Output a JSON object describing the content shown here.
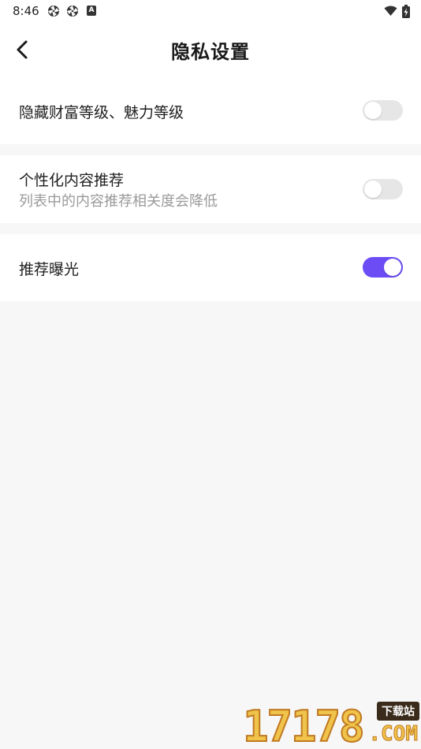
{
  "status_bar": {
    "time": "8:46",
    "left_icons": [
      "aperture-icon",
      "aperture-icon",
      "a-badge-icon"
    ],
    "a_badge": "A",
    "right_icons": [
      "wifi-icon",
      "battery-charging-icon"
    ]
  },
  "header": {
    "title": "隐私设置",
    "back_icon": "chevron-left-icon"
  },
  "settings": [
    {
      "title": "隐藏财富等级、魅力等级",
      "subtitle": "",
      "enabled": false
    },
    {
      "title": "个性化内容推荐",
      "subtitle": "列表中的内容推荐相关度会降低",
      "enabled": false
    },
    {
      "title": "推荐曝光",
      "subtitle": "",
      "enabled": true
    }
  ],
  "colors": {
    "accent": "#6b4cf5",
    "switch_off": "#e6e6e6",
    "background": "#f7f7f7",
    "subtitle": "#9a9a9a"
  },
  "watermark": {
    "digits": "17178",
    "tag": "下载站",
    "suffix": ".COM"
  }
}
